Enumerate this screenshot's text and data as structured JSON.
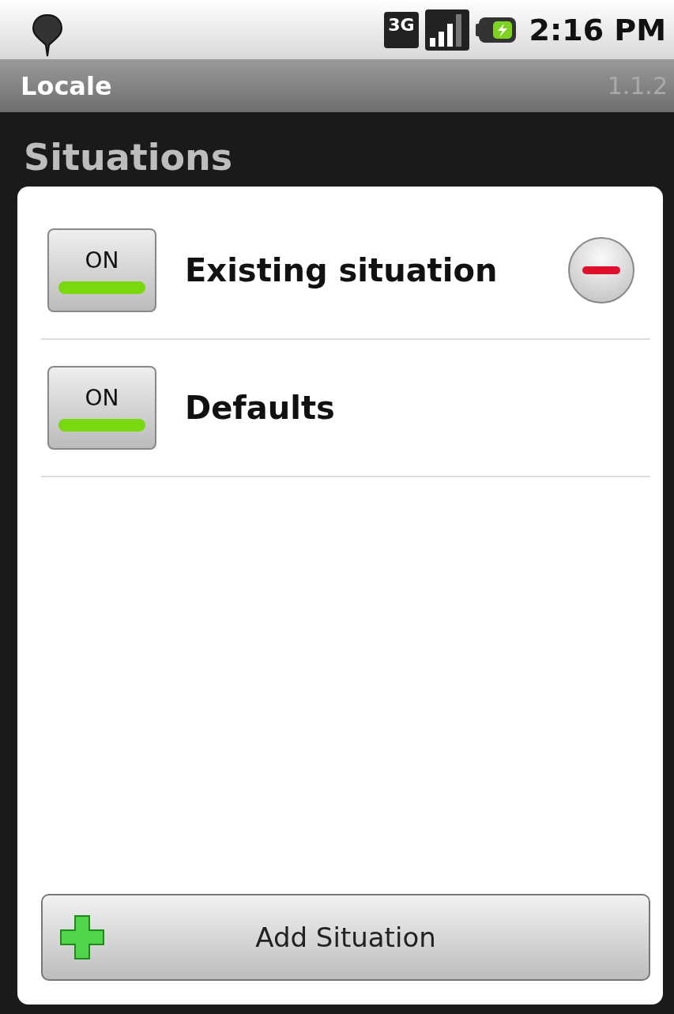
{
  "status_bar": {
    "network_label": "3G",
    "time": "2:16 PM"
  },
  "title_bar": {
    "title": "Locale",
    "version": "1.1.2"
  },
  "heading": "Situations",
  "situations": [
    {
      "name": "Existing situation",
      "toggle_label": "ON",
      "on": true,
      "removable": true
    },
    {
      "name": "Defaults",
      "toggle_label": "ON",
      "on": true,
      "removable": false
    }
  ],
  "add_button": {
    "label": "Add Situation"
  }
}
